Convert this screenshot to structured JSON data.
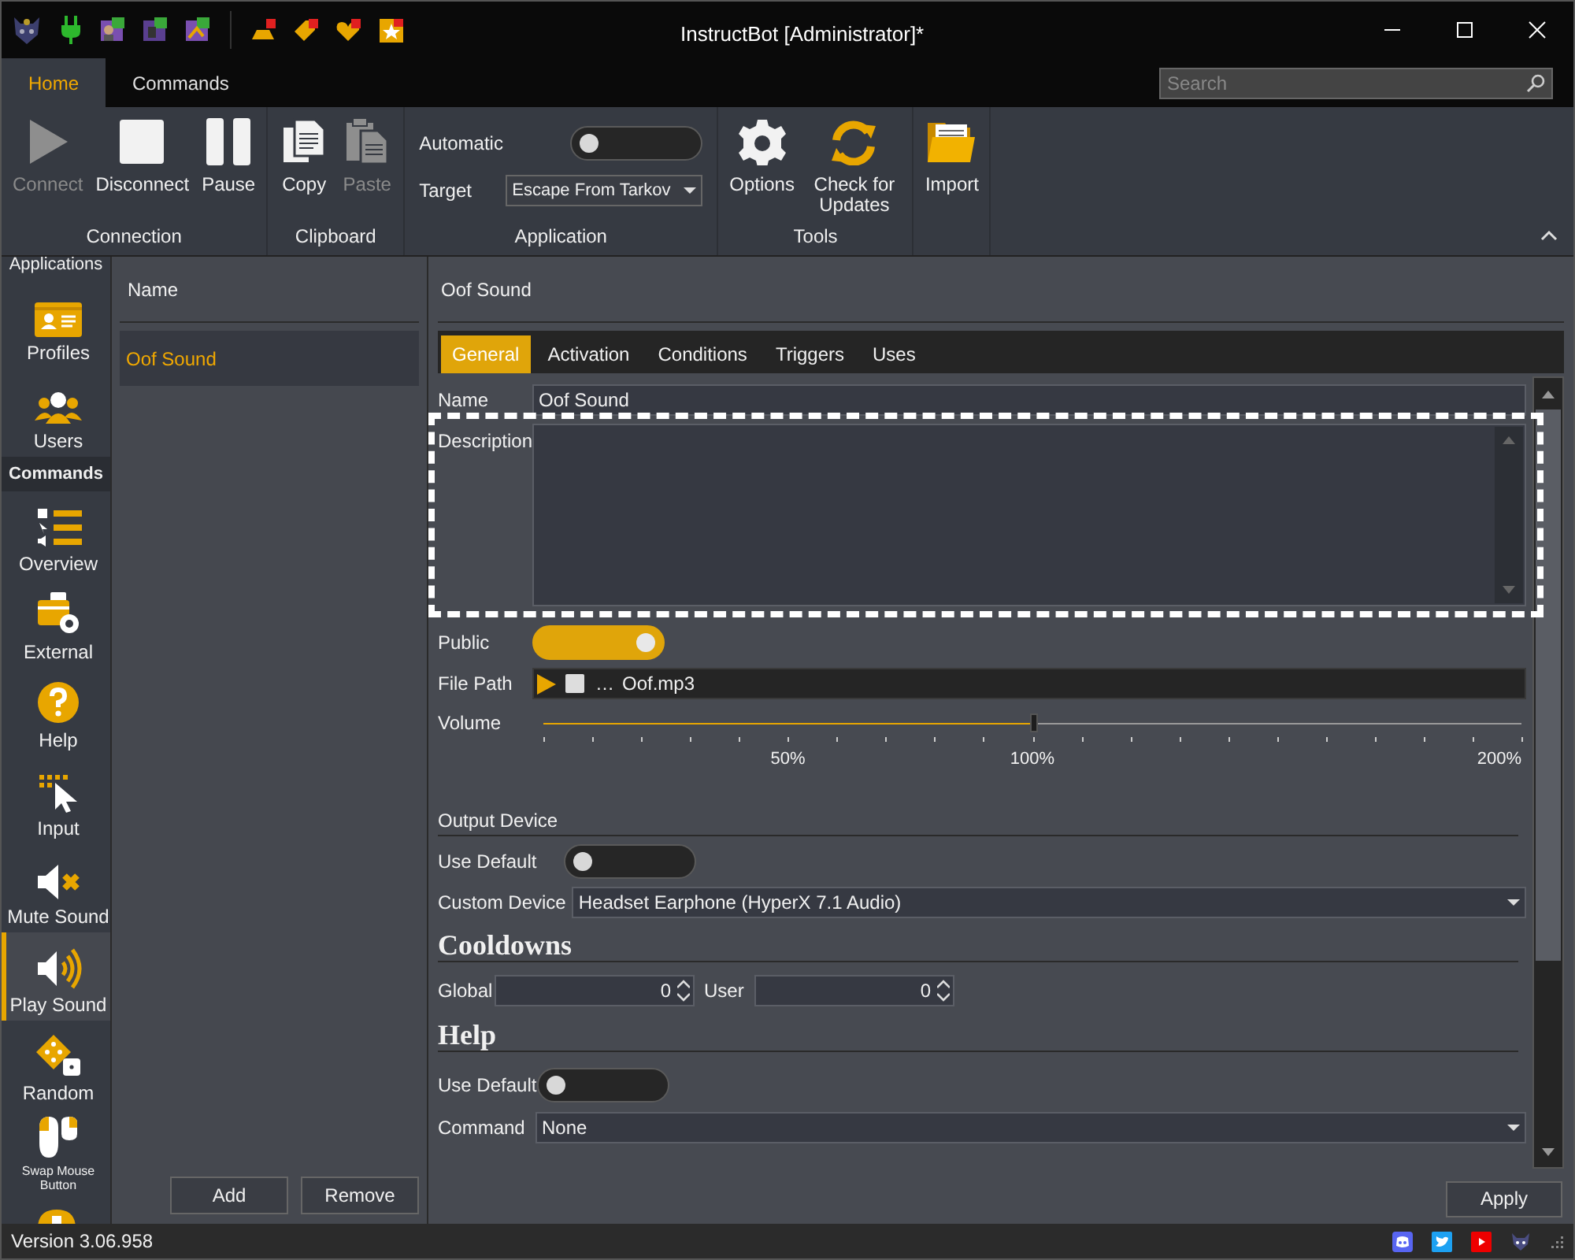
{
  "window": {
    "title": "InstructBot [Administrator]*"
  },
  "ribbon_tabs": [
    {
      "label": "Home",
      "selected": true
    },
    {
      "label": "Commands",
      "selected": false
    }
  ],
  "search": {
    "placeholder": "Search"
  },
  "ribbon_groups": [
    {
      "kind": "buttons",
      "label": "Connection",
      "buttons": [
        {
          "label": "Connect",
          "disabled": true
        },
        {
          "label": "Disconnect",
          "disabled": false
        },
        {
          "label": "Pause",
          "disabled": false
        }
      ]
    },
    {
      "kind": "buttons",
      "label": "Clipboard",
      "buttons": [
        {
          "label": "Copy",
          "disabled": false
        },
        {
          "label": "Paste",
          "disabled": true
        }
      ]
    },
    {
      "kind": "controls",
      "label": "Application",
      "automatic": {
        "label": "Automatic",
        "on": false
      },
      "target": {
        "label": "Target",
        "value": "Escape From Tarkov"
      }
    },
    {
      "kind": "buttons",
      "label": "Tools",
      "buttons": [
        {
          "label": "Options",
          "disabled": false
        },
        {
          "label": "Check for Updates",
          "disabled": false
        }
      ]
    },
    {
      "kind": "buttons",
      "buttons": [
        {
          "label": "Import",
          "disabled": false
        }
      ]
    }
  ],
  "sidebar": {
    "items": [
      {
        "kind": "item",
        "label": "Applications",
        "selected": false
      },
      {
        "kind": "item",
        "label": "Profiles",
        "selected": false
      },
      {
        "kind": "item",
        "label": "Users",
        "selected": false
      },
      {
        "kind": "header",
        "label": "Commands"
      },
      {
        "kind": "item",
        "label": "Overview",
        "selected": false
      },
      {
        "kind": "item",
        "label": "External",
        "selected": false
      },
      {
        "kind": "item",
        "label": "Help",
        "selected": false
      },
      {
        "kind": "item",
        "label": "Input",
        "selected": false
      },
      {
        "kind": "item",
        "label": "Mute Sound",
        "selected": false
      },
      {
        "kind": "item",
        "label": "Play Sound",
        "selected": true
      },
      {
        "kind": "item",
        "label": "Random",
        "selected": false
      },
      {
        "kind": "small",
        "label": "Swap Mouse Button",
        "selected": false
      }
    ]
  },
  "list": {
    "column": "Name",
    "items": [
      {
        "label": "Oof Sound",
        "selected": true
      }
    ],
    "buttons": [
      "Add",
      "Remove"
    ]
  },
  "detail": {
    "title": "Oof Sound",
    "tabs": [
      {
        "label": "General",
        "selected": true
      },
      {
        "label": "Activation",
        "selected": false
      },
      {
        "label": "Conditions",
        "selected": false
      },
      {
        "label": "Triggers",
        "selected": false
      },
      {
        "label": "Uses",
        "selected": false
      }
    ],
    "name": {
      "label": "Name",
      "value": "Oof Sound"
    },
    "description": {
      "label": "Description",
      "highlighted": true
    },
    "public": {
      "label": "Public",
      "on": true
    },
    "file_path": {
      "label": "File Path",
      "browse": "…",
      "value": "Oof.mp3"
    },
    "volume": {
      "label": "Volume",
      "level": 0.5,
      "ticks": [
        "50%",
        "100%",
        "200%"
      ]
    },
    "output_device": {
      "heading": "Output Device",
      "use_default": {
        "label": "Use Default",
        "on": false
      },
      "custom_device": {
        "label": "Custom Device",
        "value": "Headset Earphone (HyperX 7.1 Audio)"
      }
    },
    "cooldowns": {
      "heading": "Cooldowns",
      "global": {
        "label": "Global",
        "value": "0"
      },
      "user": {
        "label": "User",
        "value": "0"
      }
    },
    "help": {
      "heading": "Help",
      "use_default": {
        "label": "Use Default",
        "on": false
      },
      "command": {
        "label": "Command",
        "value": "None"
      }
    },
    "apply": "Apply"
  },
  "status_bar": {
    "version": "Version 3.06.958"
  }
}
